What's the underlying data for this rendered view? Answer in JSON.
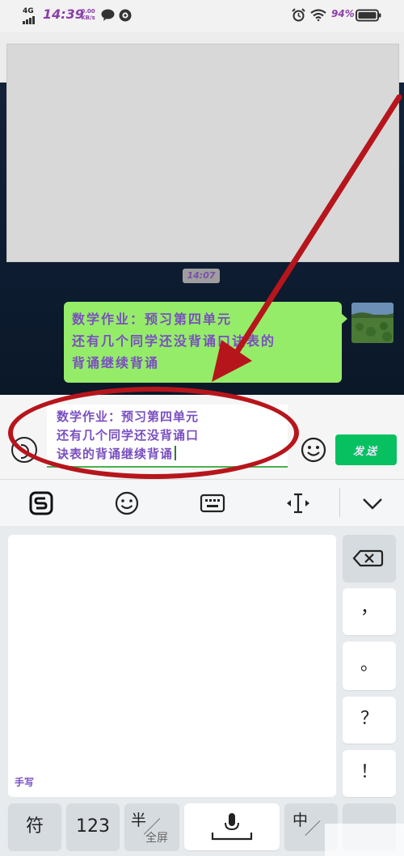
{
  "status_bar": {
    "network": "4G",
    "time": "14:39",
    "speed_value": "0.00",
    "speed_unit": "KB/s",
    "battery_percent": "94%",
    "icons": [
      "signal-icon",
      "chat-notification-icon",
      "settings-notification-icon",
      "alarm-icon",
      "wifi-icon",
      "battery-icon"
    ]
  },
  "chat": {
    "timestamp": "14:07",
    "message": "数学作业：预习第四单元\n还有几个同学还没背诵口诀表的\n背诵继续背诵",
    "avatar_icon": "avatar-landscape-photo"
  },
  "composer": {
    "draft_text": "数学作业：预习第四单元\n还有几个同学还没背诵口\n诀表的背诵继续背诵",
    "send_label": "发送",
    "voice_icon": "voice-icon",
    "emoji_icon": "emoji-icon"
  },
  "ime_toolbar": {
    "items": [
      "sogou-logo-icon",
      "emoji-icon",
      "keyboard-icon",
      "cursor-move-icon",
      "collapse-chevron-icon"
    ]
  },
  "keyboard": {
    "handwriting_label": "手写",
    "keys": {
      "comma": "，",
      "period": "。",
      "question": "？",
      "exclamation": "！",
      "symbols": "符",
      "numbers": "123",
      "half_main": "半",
      "half_sub": "全屏",
      "zh_main": "中"
    }
  },
  "colors": {
    "send_green": "#07c160",
    "bubble_green": "#95ec69",
    "annotation_red": "#b7151c",
    "text_purple": "#7a4fc0"
  }
}
